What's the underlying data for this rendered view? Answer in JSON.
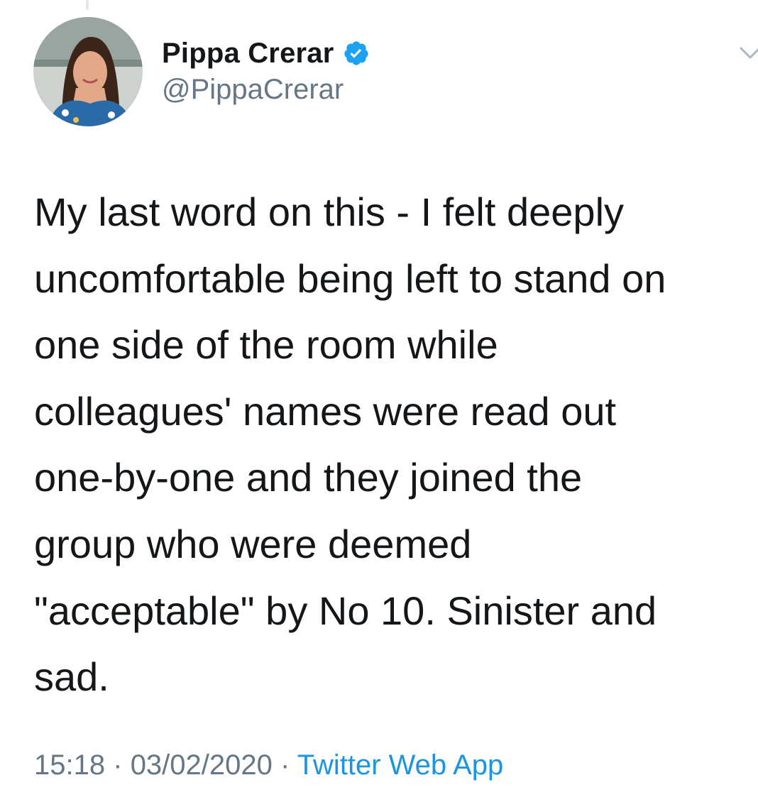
{
  "tweet": {
    "author": {
      "name": "Pippa Crerar",
      "handle": "@PippaCrerar",
      "verified": true,
      "verified_icon": "verified-badge-icon"
    },
    "menu_icon": "chevron-down-icon",
    "text_lines": [
      "My last word on this - I felt deeply",
      "uncomfortable being left to stand on",
      "one side of the room while",
      "colleagues' names were read out",
      "one-by-one and they joined the",
      "group who were deemed",
      "\"acceptable\" by No 10. Sinister and",
      "sad."
    ],
    "meta": {
      "time": "15:18",
      "separator": "·",
      "date": "03/02/2020",
      "source": "Twitter Web App"
    }
  },
  "colors": {
    "text": "#14171a",
    "secondary": "#657786",
    "link": "#1b95e0",
    "verified": "#1da1f2"
  }
}
